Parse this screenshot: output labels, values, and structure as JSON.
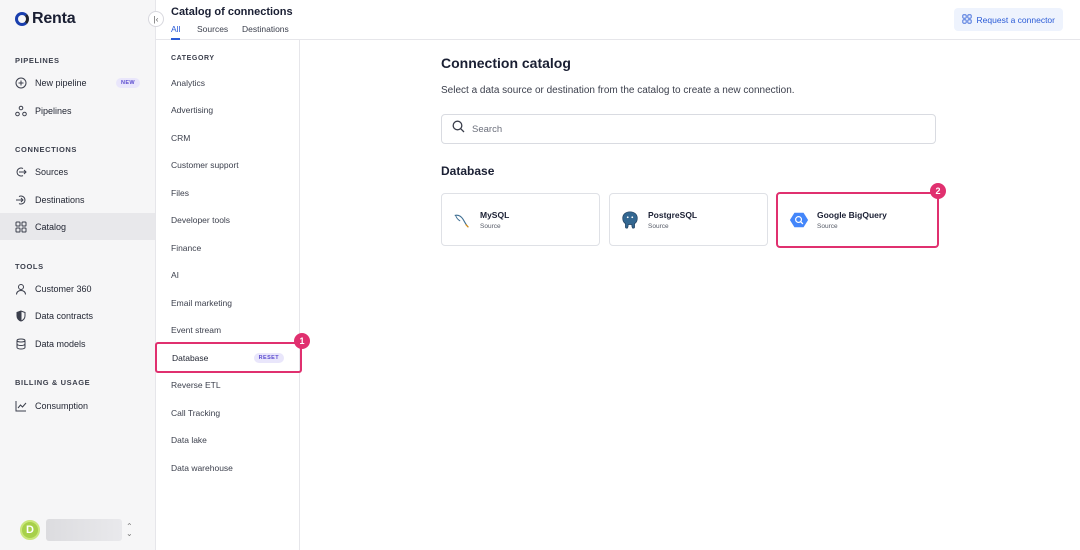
{
  "brand": {
    "name": "Renta"
  },
  "sidebar": {
    "sections": {
      "pipelines": "PIPELINES",
      "connections": "CONNECTIONS",
      "tools": "TOOLS",
      "billing": "BILLING & USAGE"
    },
    "items": {
      "new_pipeline": {
        "label": "New pipeline",
        "badge": "NEW",
        "icon": "plus-circle-icon"
      },
      "pipelines": {
        "label": "Pipelines",
        "icon": "pipeline-icon"
      },
      "sources": {
        "label": "Sources",
        "icon": "source-icon"
      },
      "destinations": {
        "label": "Destinations",
        "icon": "destination-icon"
      },
      "catalog": {
        "label": "Catalog",
        "icon": "grid-icon",
        "active": true
      },
      "customer360": {
        "label": "Customer 360",
        "icon": "user-icon"
      },
      "data_contracts": {
        "label": "Data contracts",
        "icon": "shield-icon"
      },
      "data_models": {
        "label": "Data models",
        "icon": "database-icon"
      },
      "consumption": {
        "label": "Consumption",
        "icon": "chart-icon"
      }
    },
    "user": {
      "initial": "D"
    }
  },
  "header": {
    "title": "Catalog of connections",
    "tabs": [
      "All",
      "Sources",
      "Destinations"
    ],
    "active_tab": "All",
    "request_button": "Request a connector"
  },
  "category": {
    "heading": "CATEGORY",
    "items": [
      "Analytics",
      "Advertising",
      "CRM",
      "Customer support",
      "Files",
      "Developer tools",
      "Finance",
      "AI",
      "Email marketing",
      "Event stream",
      "Database",
      "Reverse ETL",
      "Call Tracking",
      "Data lake",
      "Data warehouse"
    ],
    "selected": "Database",
    "reset_label": "RESET"
  },
  "main": {
    "title": "Connection catalog",
    "subtitle": "Select a data source or destination from the catalog to create a new connection.",
    "search_placeholder": "Search",
    "section": "Database",
    "cards": [
      {
        "name": "MySQL",
        "type": "Source",
        "icon": "mysql-icon"
      },
      {
        "name": "PostgreSQL",
        "type": "Source",
        "icon": "postgresql-icon"
      },
      {
        "name": "Google BigQuery",
        "type": "Source",
        "icon": "bigquery-icon"
      }
    ]
  },
  "markers": [
    "1",
    "2"
  ],
  "colors": {
    "accent": "#2a5bd7",
    "highlight": "#e0306f",
    "badge": "#5b4ccf"
  }
}
